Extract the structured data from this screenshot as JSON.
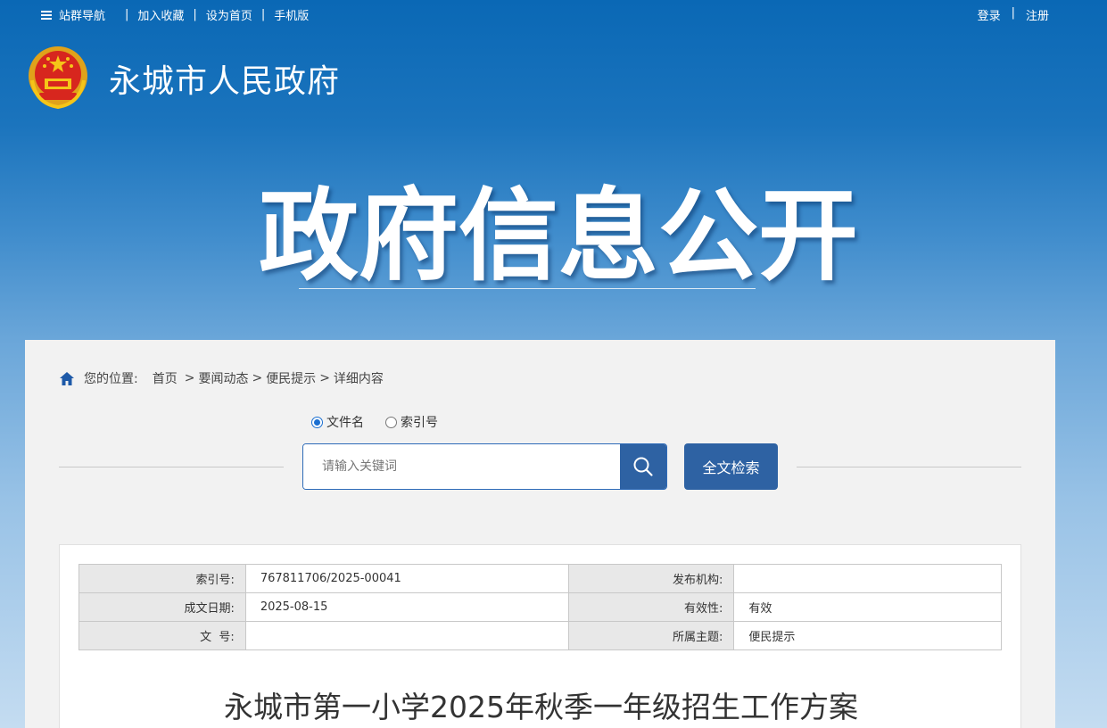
{
  "topbar": {
    "nav_label": "站群导航",
    "favorite_label": "加入收藏",
    "homepage_label": "设为首页",
    "mobile_label": "手机版",
    "separator": "|",
    "login_label": "登录",
    "register_label": "注册"
  },
  "header": {
    "site_title": "永城市人民政府",
    "hero_text": "政府信息公开",
    "emblem_icon": "national-emblem-icon"
  },
  "breadcrumb": {
    "prefix": "您的位置:",
    "items": [
      "首页",
      "要闻动态",
      "便民提示",
      "详细内容"
    ],
    "separator": ">"
  },
  "search": {
    "options": [
      {
        "label": "文件名",
        "checked": true
      },
      {
        "label": "索引号",
        "checked": false
      }
    ],
    "placeholder": "请输入关键词",
    "value": "",
    "fulltext_label": "全文检索"
  },
  "meta": {
    "rows": [
      {
        "k1": "索引号:",
        "v1": "767811706/2025-00041",
        "k2": "发布机构:",
        "v2": ""
      },
      {
        "k1": "成文日期:",
        "v1": "2025-08-15",
        "k2": "有效性:",
        "v2": "有效"
      },
      {
        "k1": "文  号:",
        "v1": "",
        "k2": "所属主题:",
        "v2": "便民提示"
      }
    ]
  },
  "document": {
    "title": "永城市第一小学2025年秋季一年级招生工作方案"
  },
  "colors": {
    "header_blue": "#0a68b5",
    "button_blue": "#2e62a3",
    "panel_bg": "#f2f2f2"
  }
}
